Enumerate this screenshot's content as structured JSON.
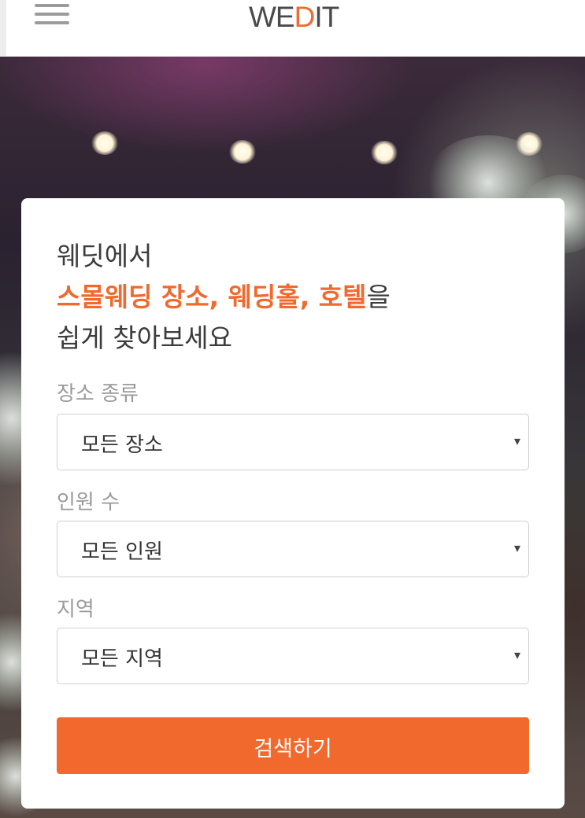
{
  "header": {
    "logo": {
      "part1": "WE",
      "part2": "D",
      "part3": "IT"
    },
    "menu_icon": "hamburger-menu-icon"
  },
  "search": {
    "headline": {
      "line1": "웨딧에서",
      "line2_highlight": "스몰웨딩 장소, 웨딩홀, 호텔",
      "line2_suffix": "을",
      "line3": "쉽게 찾아보세요"
    },
    "fields": [
      {
        "label": "장소 종류",
        "value": "모든 장소",
        "caret": "▾"
      },
      {
        "label": "인원 수",
        "value": "모든 인원",
        "caret": "▾"
      },
      {
        "label": "지역",
        "value": "모든 지역",
        "caret": "▾"
      }
    ],
    "button_label": "검색하기"
  },
  "colors": {
    "accent": "#f06a2e",
    "button": "#f2692d",
    "text": "#333333",
    "label": "#9a9a9a"
  }
}
